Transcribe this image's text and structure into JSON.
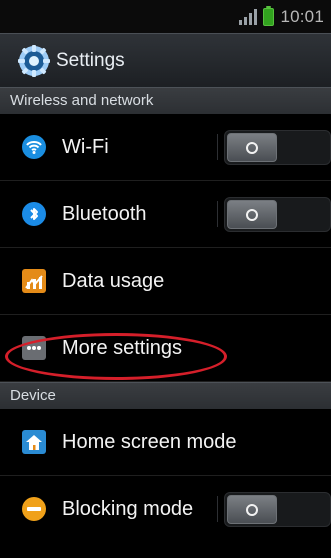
{
  "status_bar": {
    "time": "10:01"
  },
  "app_bar": {
    "title": "Settings"
  },
  "sections": {
    "wireless": "Wireless and network",
    "device": "Device"
  },
  "items": {
    "wifi": "Wi-Fi",
    "bluetooth": "Bluetooth",
    "data_usage": "Data usage",
    "more_settings": "More settings",
    "home_screen_mode": "Home screen mode",
    "blocking_mode": "Blocking mode"
  },
  "colors": {
    "accent_red": "#d51f2a",
    "wifi_blue": "#1a8ee0",
    "bluetooth_blue": "#1b8be6",
    "data_orange": "#e48b18",
    "blocking_orange": "#f0a11a"
  },
  "icons": {
    "app": "gear-icon",
    "wifi": "wifi-icon",
    "bluetooth": "bluetooth-icon",
    "data_usage": "data-usage-icon",
    "more_settings": "more-dots-icon",
    "home_screen_mode": "home-icon",
    "blocking_mode": "blocking-icon"
  }
}
